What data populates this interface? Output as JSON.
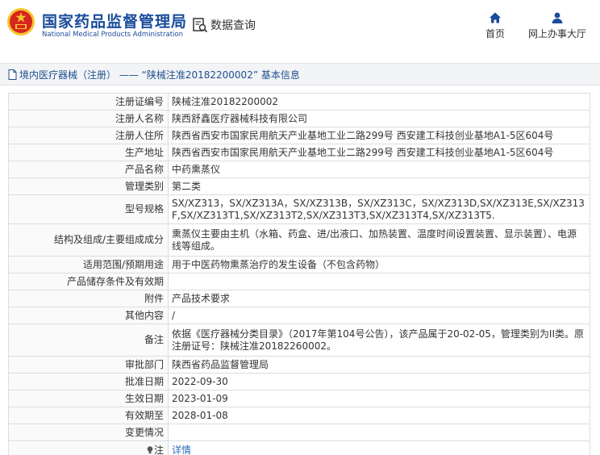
{
  "header": {
    "brand_cn": "国家药品监督管理局",
    "brand_en": "National Medical Products Administration",
    "query_label": "数据查询",
    "nav": {
      "home": "首页",
      "hall": "网上办事大厅"
    },
    "accent": "#1a4c9c",
    "logo_accent": "#d7261e"
  },
  "breadcrumb": {
    "text": "境内医疗器械（注册） —— “陕械注准20182200002” 基本信息"
  },
  "rows": [
    {
      "label": "注册证编号",
      "value": "陕械注准20182200002"
    },
    {
      "label": "注册人名称",
      "value": "陕西舒鑫医疗器械科技有限公司"
    },
    {
      "label": "注册人住所",
      "value": "陕西省西安市国家民用航天产业基地工业二路299号 西安建工科技创业基地A1-5区604号"
    },
    {
      "label": "生产地址",
      "value": "陕西省西安市国家民用航天产业基地工业二路299号 西安建工科技创业基地A1-5区604号"
    },
    {
      "label": "产品名称",
      "value": "中药熏蒸仪"
    },
    {
      "label": "管理类别",
      "value": "第二类"
    },
    {
      "label": "型号规格",
      "value": "SX/XZ313，SX/XZ313A，SX/XZ313B，SX/XZ313C，SX/XZ313D,SX/XZ313E,SX/XZ313F,SX/XZ313T1,SX/XZ313T2,SX/XZ313T3,SX/XZ313T4,SX/XZ313T5."
    },
    {
      "label": "结构及组成/主要组成成分",
      "value": "熏蒸仪主要由主机（水箱、药盒、进/出液口、加热装置、温度时间设置装置、显示装置）、电源线等组成。"
    },
    {
      "label": "适用范围/预期用途",
      "value": "用于中医药物熏蒸治疗的发生设备（不包含药物）"
    },
    {
      "label": "产品储存条件及有效期",
      "value": ""
    },
    {
      "label": "附件",
      "value": "产品技术要求"
    },
    {
      "label": "其他内容",
      "value": "/"
    },
    {
      "label": "备注",
      "value": "依据《医疗器械分类目录》（2017年第104号公告），该产品属于20-02-05，管理类别为II类。原注册证号：陕械注准20182260002。"
    },
    {
      "label": "审批部门",
      "value": "陕西省药品监督管理局"
    },
    {
      "label": "批准日期",
      "value": "2022-09-30"
    },
    {
      "label": "生效日期",
      "value": "2023-01-09"
    },
    {
      "label": "有效期至",
      "value": "2028-01-08"
    },
    {
      "label": "变更情况",
      "value": ""
    }
  ],
  "note_row": {
    "label": "注",
    "link": "详情"
  }
}
